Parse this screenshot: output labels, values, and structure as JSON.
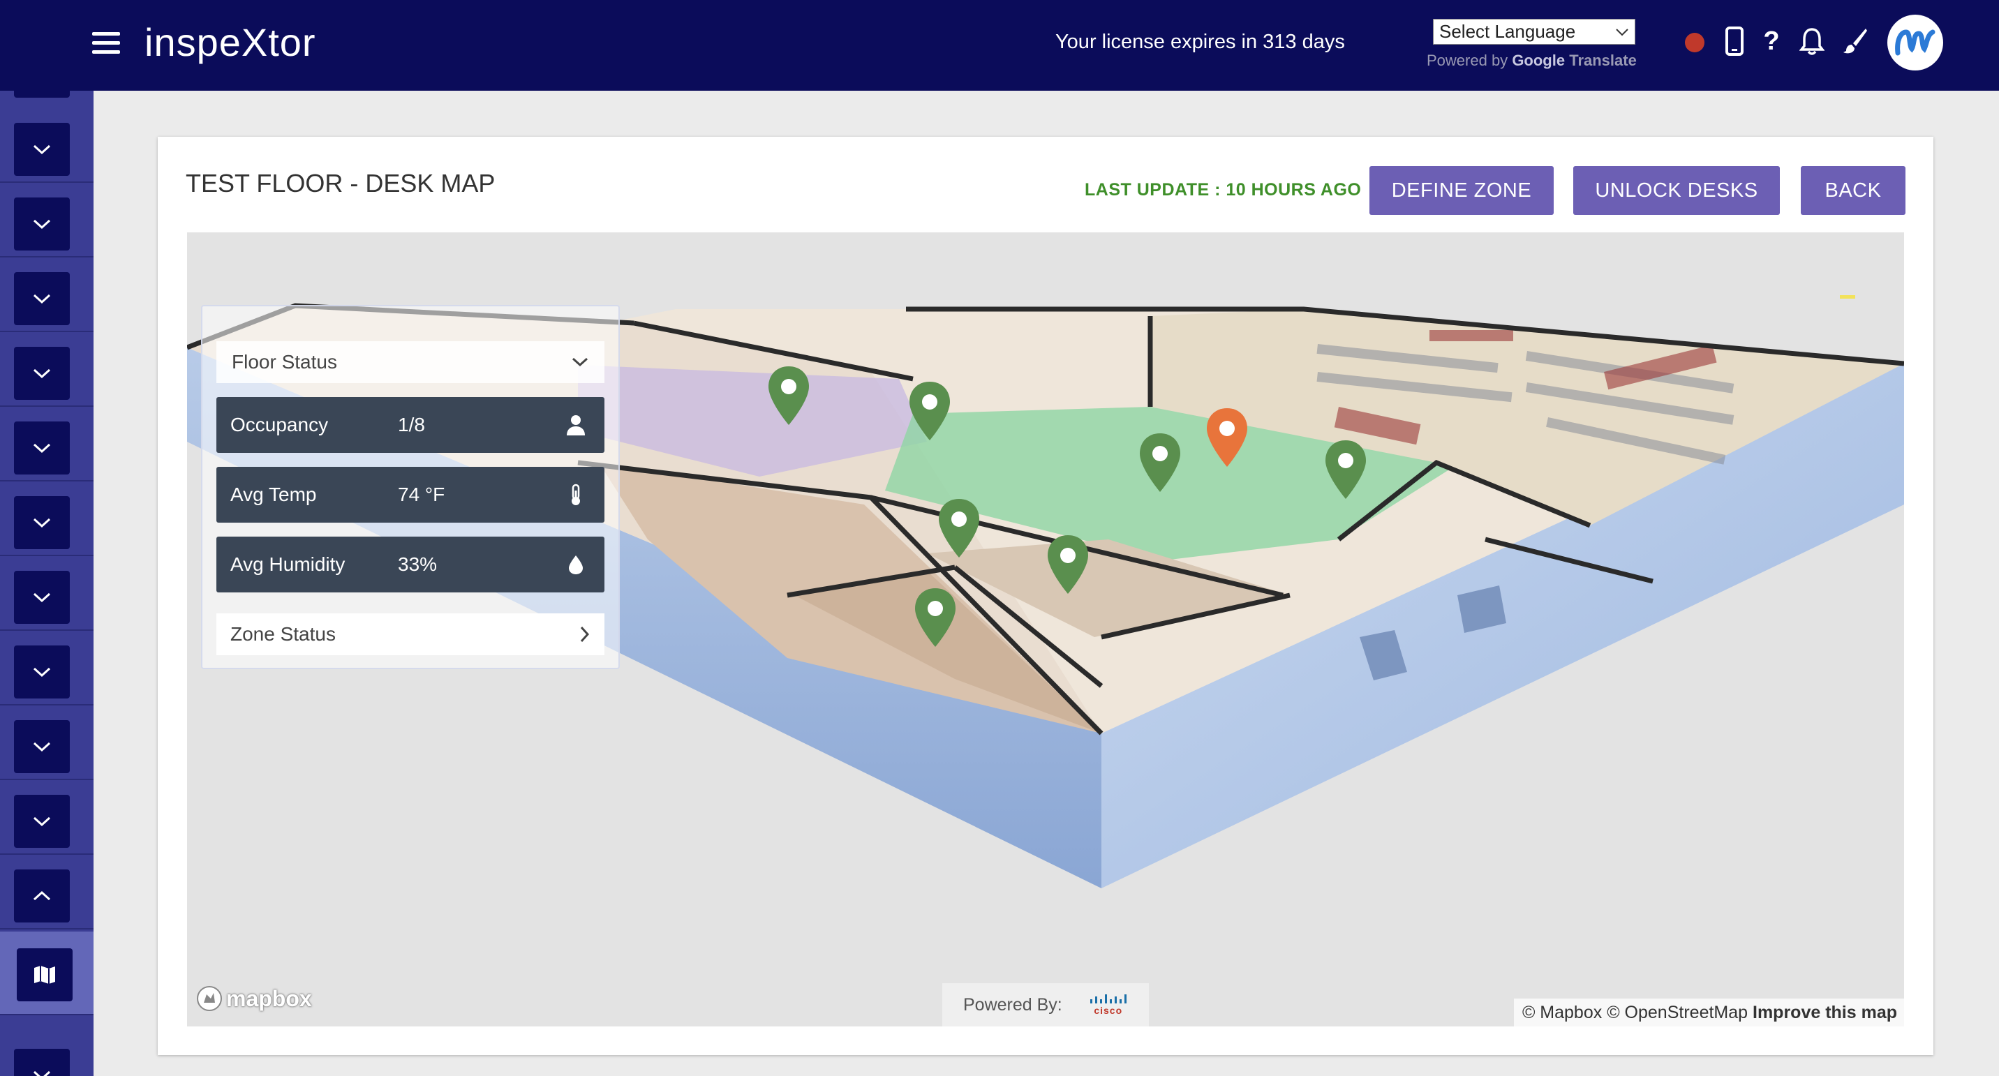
{
  "header": {
    "brand": "inspeXtor",
    "license_text": "Your license expires in 313 days",
    "language_select": "Select Language",
    "powered_by_prefix": "Powered by",
    "powered_by_google": "Google",
    "powered_by_translate": "Translate",
    "icons": [
      "recording-indicator",
      "mobile-icon",
      "help-icon",
      "bell-icon",
      "brush-icon",
      "avatar"
    ]
  },
  "sidebar": {
    "items_expanded": 11,
    "icons": [
      "chevron-down-icon",
      "chevron-up-icon",
      "map-icon"
    ]
  },
  "page": {
    "title": "TEST FLOOR - DESK MAP",
    "last_update": "LAST UPDATE : 10 HOURS AGO",
    "buttons": {
      "define_zone": "DEFINE ZONE",
      "unlock_desks": "UNLOCK DESKS",
      "back": "BACK"
    }
  },
  "panel": {
    "floor_status": "Floor Status",
    "metrics": [
      {
        "label": "Occupancy",
        "value": "1/8",
        "icon": "person-icon"
      },
      {
        "label": "Avg Temp",
        "value": "74 °F",
        "icon": "thermometer-icon"
      },
      {
        "label": "Avg Humidity",
        "value": "33%",
        "icon": "droplet-icon"
      }
    ],
    "zone_status": "Zone Status"
  },
  "map": {
    "pins": [
      {
        "status": "available",
        "color": "#5a8f4e"
      },
      {
        "status": "available",
        "color": "#5a8f4e"
      },
      {
        "status": "occupied",
        "color": "#e8743b"
      },
      {
        "status": "available",
        "color": "#5a8f4e"
      },
      {
        "status": "available",
        "color": "#5a8f4e"
      },
      {
        "status": "available",
        "color": "#5a8f4e"
      },
      {
        "status": "available",
        "color": "#5a8f4e"
      },
      {
        "status": "available",
        "color": "#5a8f4e"
      },
      {
        "status": "available",
        "color": "#5a8f4e"
      }
    ],
    "mapbox_logo": "mapbox",
    "powered_by": "Powered By:",
    "cisco": "cisco",
    "attribution": "© Mapbox © OpenStreetMap",
    "improve": "Improve this map"
  },
  "colors": {
    "topbar": "#0b0c5a",
    "sidebar": "#3b3d94",
    "button": "#6c5fb4",
    "last_update": "#3f8f2a",
    "metric_bg": "#3a4656"
  }
}
